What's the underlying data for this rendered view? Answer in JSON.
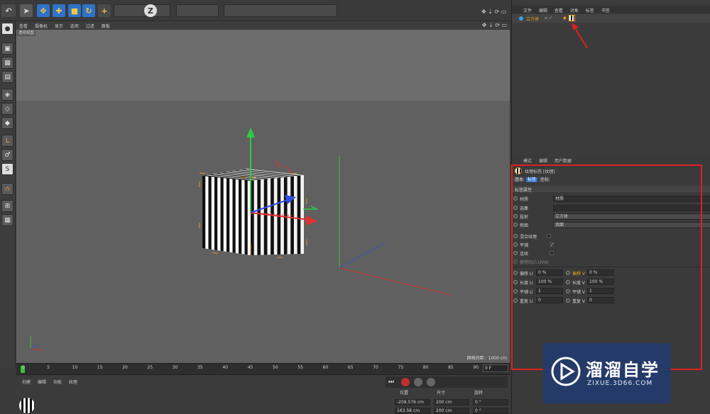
{
  "viewport_menu": [
    "查看",
    "摄像机",
    "显示",
    "选项",
    "过滤",
    "面板"
  ],
  "viewport_label": "透视视图",
  "viewport_info": "网格间距：1000 cm",
  "timeline": {
    "ticks": [
      "0",
      "5",
      "10",
      "15",
      "20",
      "25",
      "30",
      "35",
      "40",
      "45",
      "50",
      "55",
      "60",
      "65",
      "70",
      "75",
      "80",
      "85",
      "90"
    ],
    "frame": "0 F"
  },
  "bottom": {
    "menu": [
      "创建",
      "编辑",
      "功能",
      "纹理"
    ],
    "coord_headers": [
      "位置",
      "尺寸",
      "旋转"
    ],
    "row1": [
      "-209.576 cm",
      "200 cm",
      "0 °"
    ],
    "row2": [
      "163.58 cm",
      "200 cm",
      "0 °"
    ]
  },
  "object_manager": {
    "menu": [
      "文件",
      "编辑",
      "查看",
      "对象",
      "标签",
      "书签"
    ],
    "object_name": "立方体"
  },
  "attribute_manager": {
    "menu": [
      "模式",
      "编辑",
      "用户数据"
    ],
    "tag_title": "纹理标签 [纹理]",
    "tabs": [
      "基本",
      "标签",
      "坐标"
    ],
    "section": "标签属性",
    "material_label": "材质",
    "material_value": "材质",
    "select_label": "选集",
    "projection_label": "投射",
    "projection_value": "立方体",
    "side_label": "侧面",
    "side_value": "双面",
    "mix_label": "混合纹理",
    "tile_label": "平铺",
    "seamless_label": "连续",
    "uvw_label": "使用凹凸 UVW",
    "offset_u_label": "偏移 U",
    "offset_u": "0 %",
    "offset_v_label": "偏移 V",
    "offset_v": "0 %",
    "length_u_label": "长度 U",
    "length_u": "100 %",
    "length_v_label": "长度 V",
    "length_v": "100 %",
    "tiles_u_label": "平铺 U",
    "tiles_u": "1",
    "tiles_v_label": "平铺 V",
    "tiles_v": "1",
    "repeat_u_label": "重复 U",
    "repeat_u": "0",
    "repeat_v_label": "重复 V",
    "repeat_v": "0"
  },
  "watermark": {
    "title": "溜溜自学",
    "url": "ZIXUE.3D66.COM"
  },
  "colors": {
    "highlight": "#e02020",
    "accent": "#f0a020"
  }
}
